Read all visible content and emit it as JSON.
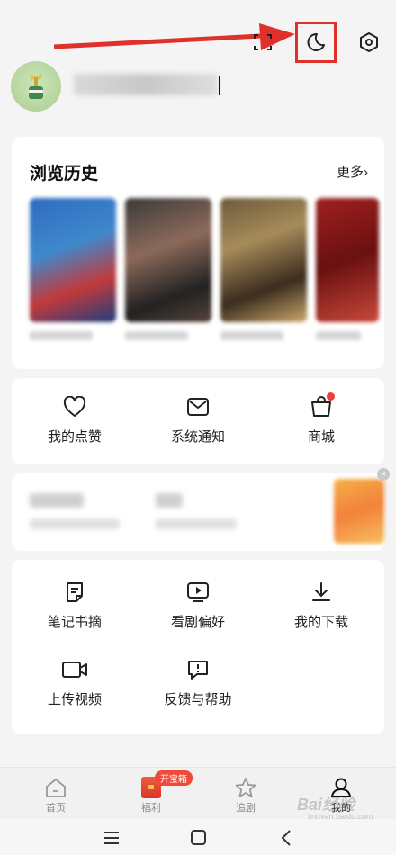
{
  "header": {
    "icons": [
      "scan-icon",
      "night-mode-icon",
      "settings-icon"
    ]
  },
  "history": {
    "title": "浏览历史",
    "more_label": "更多",
    "chevron": "›"
  },
  "quick_actions": [
    {
      "label": "我的点赞",
      "icon": "heart-icon"
    },
    {
      "label": "系统通知",
      "icon": "mail-icon"
    },
    {
      "label": "商城",
      "icon": "bag-icon"
    }
  ],
  "tools": [
    {
      "label": "笔记书摘",
      "icon": "note-icon"
    },
    {
      "label": "看剧偏好",
      "icon": "play-screen-icon"
    },
    {
      "label": "我的下载",
      "icon": "download-icon"
    },
    {
      "label": "上传视频",
      "icon": "video-camera-icon"
    },
    {
      "label": "反馈与帮助",
      "icon": "feedback-icon"
    }
  ],
  "tabbar": {
    "tabs": [
      {
        "label": "首页",
        "icon": "home-icon"
      },
      {
        "label": "福利",
        "icon": "treasure-chest-icon"
      },
      {
        "label": "追剧",
        "icon": "star-icon"
      },
      {
        "label": "我的",
        "icon": "user-icon"
      }
    ],
    "badge": "开宝箱",
    "active": "我的"
  },
  "watermark": {
    "text": "Bai经验",
    "sub": "jingyan.baidu.com"
  },
  "colors": {
    "accent_red": "#e0302b",
    "badge_red": "#f04a3a",
    "background": "#f4f4f5"
  }
}
